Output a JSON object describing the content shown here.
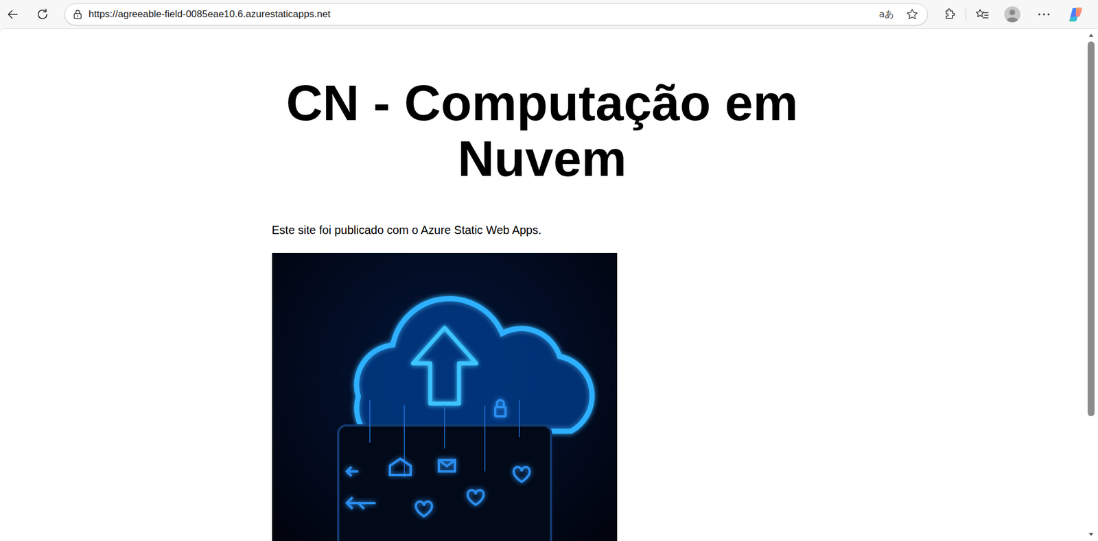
{
  "browser": {
    "url": "https://agreeable-field-0085eae10.6.azurestaticapps.net",
    "translate_icon": "aあ"
  },
  "page": {
    "heading": "CN - Computação em Nuvem",
    "paragraph": "Este site foi publicado com o Azure Static Web Apps."
  },
  "scrollbar": {
    "level": 0.77
  }
}
